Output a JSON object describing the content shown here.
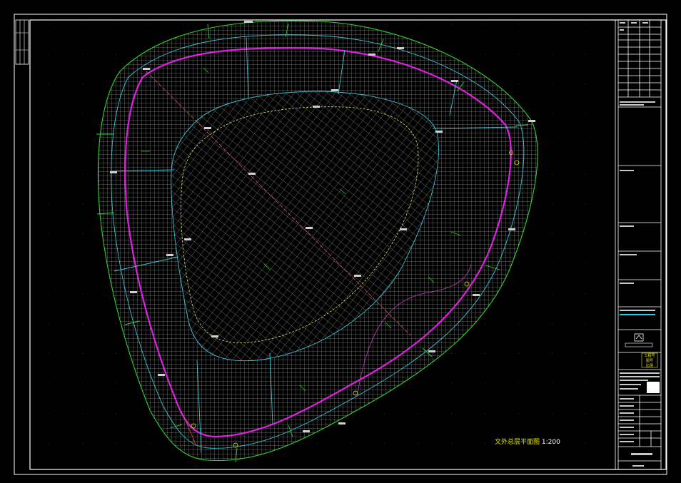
{
  "drawing": {
    "caption_cn": "文外总层平面图",
    "caption_scale": "1:200",
    "colors": {
      "background": "#000000",
      "frame": "#ffffff",
      "outer_boundary": "#2fd42f",
      "grid": "#e6e6e6",
      "section_lines": "#39c6d8",
      "track": "#e020e0",
      "axis": "#e04040",
      "inner_contour": "#e8e070",
      "annotation": "#e8e800"
    },
    "title_block": {
      "stamp_lines": [
        "工程号",
        "图号",
        "比例"
      ]
    }
  }
}
